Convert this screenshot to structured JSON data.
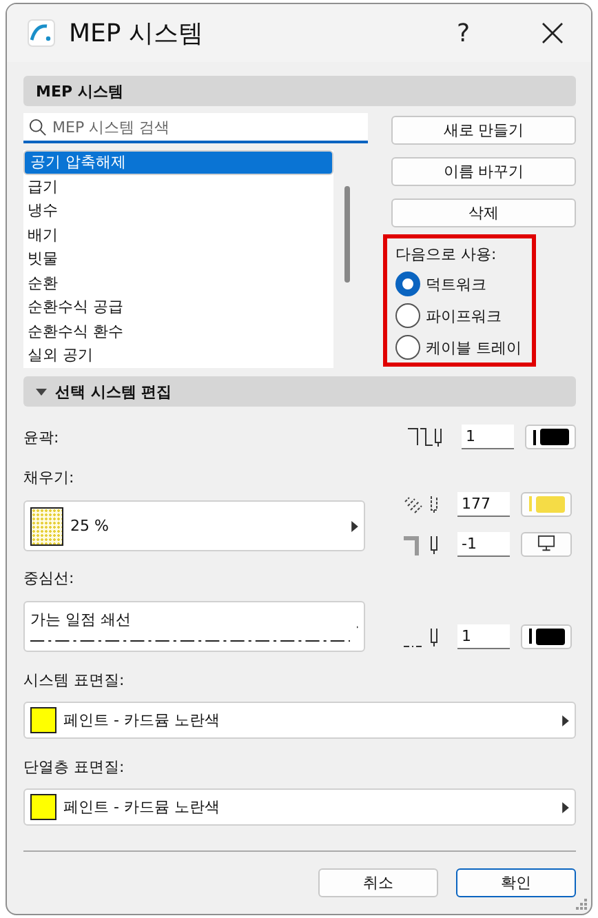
{
  "window": {
    "title": "MEP 시스템",
    "help": "?"
  },
  "systems": {
    "title": "MEP 시스템",
    "search": {
      "placeholder": "MEP 시스템 검색"
    },
    "items": [
      {
        "label": "공기 압축해제",
        "selected": true
      },
      {
        "label": "급기",
        "selected": false
      },
      {
        "label": "냉수",
        "selected": false
      },
      {
        "label": "배기",
        "selected": false
      },
      {
        "label": "빗물",
        "selected": false
      },
      {
        "label": "순환",
        "selected": false
      },
      {
        "label": "순환수식 공급",
        "selected": false
      },
      {
        "label": "순환수식 환수",
        "selected": false
      },
      {
        "label": "실외 공기",
        "selected": false
      }
    ],
    "buttons": [
      "새로 만들기",
      "이름 바꾸기",
      "삭제"
    ],
    "use_as": {
      "label": "다음으로 사용:",
      "options": [
        {
          "label": "덕트워크",
          "selected": true
        },
        {
          "label": "파이프워크",
          "selected": false
        },
        {
          "label": "케이블 트레이",
          "selected": false
        }
      ]
    }
  },
  "edit": {
    "title": "선택 시스템 편집",
    "expanded": true,
    "contour": {
      "label": "윤곽:",
      "pen": "1",
      "color": "#000000"
    },
    "fill": {
      "label": "채우기:",
      "value": "25 %",
      "fg_pen": "177",
      "color": "#f5dc46",
      "bg_pen": "-1"
    },
    "centerline": {
      "label": "중심선:",
      "value": "가는 일점 쇄선",
      "pen": "1",
      "color": "#000000"
    },
    "surfaces": [
      {
        "label": "시스템 표면질:",
        "value": "페인트 - 카드뮴 노란색",
        "color": "#ffff00"
      },
      {
        "label": "단열층 표면질:",
        "value": "페인트 - 카드뮴 노란색",
        "color": "#ffff00"
      }
    ]
  },
  "footer": {
    "buttons": [
      {
        "label": "취소",
        "kind": "secondary"
      },
      {
        "label": "확인",
        "kind": "primary"
      }
    ]
  }
}
